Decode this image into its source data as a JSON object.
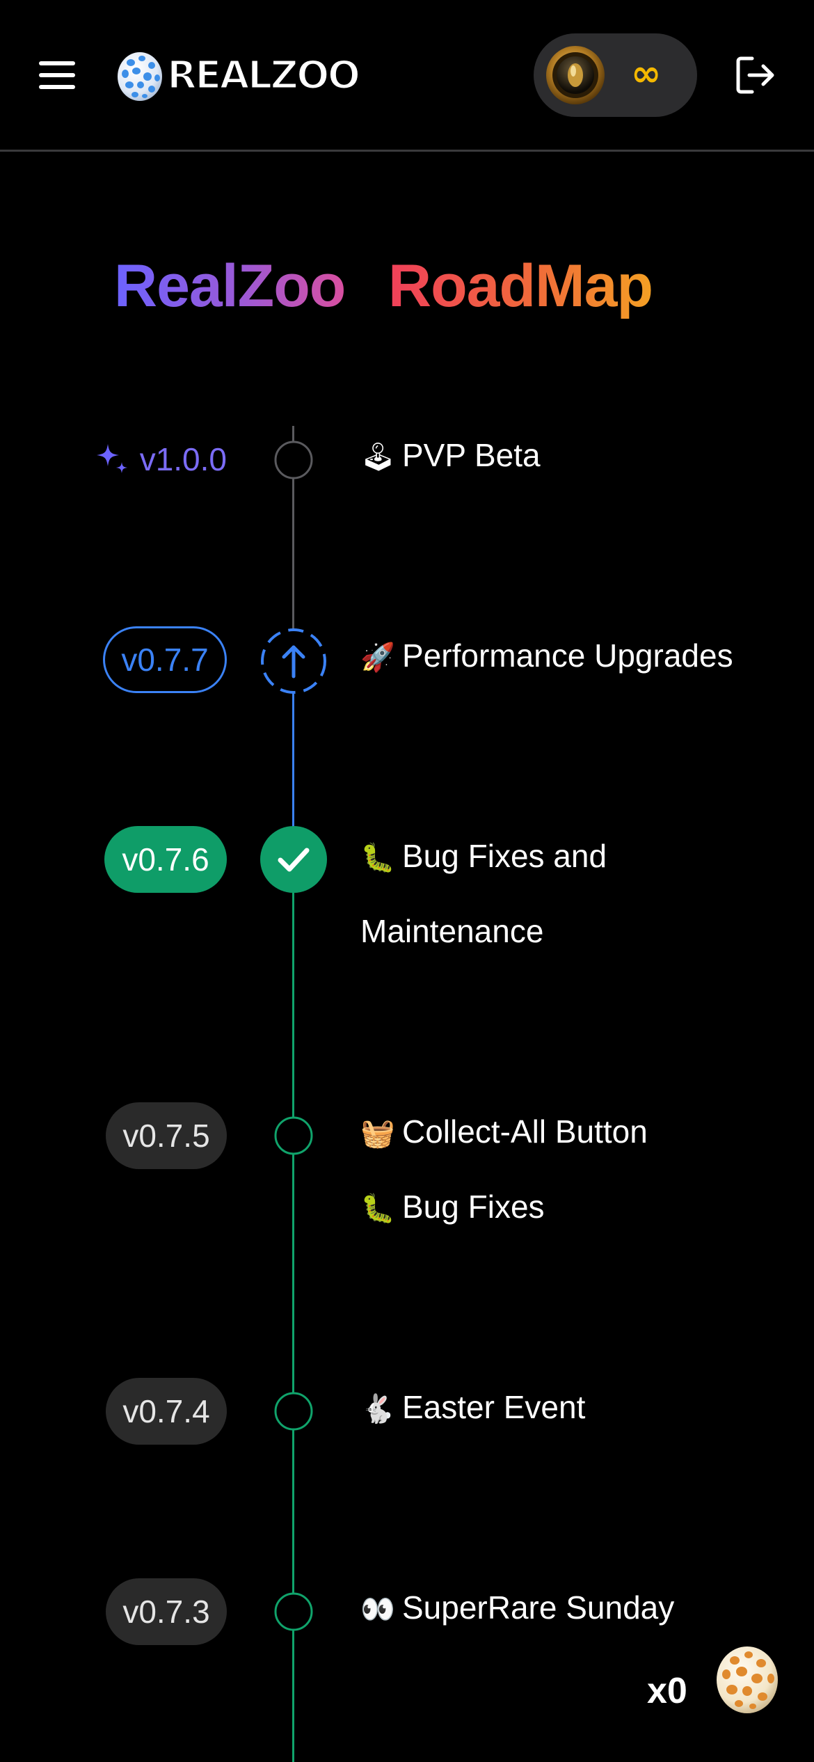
{
  "header": {
    "logo_text": "REALZOO",
    "balance": "∞",
    "icons": [
      "menu-icon",
      "egg-logo-icon",
      "coin-icon",
      "logout-icon"
    ]
  },
  "title": {
    "part1": "RealZoo",
    "part2": "RoadMap"
  },
  "colors": {
    "background": "#000000",
    "upcoming": "#7b6cf6",
    "in_progress": "#3b82f6",
    "released": "#0f9d68",
    "balance": "#f5b800"
  },
  "roadmap": [
    {
      "version": "v1.0.0",
      "status": "planned",
      "items": [
        {
          "emoji": "🕹",
          "text": "PVP Beta"
        }
      ]
    },
    {
      "version": "v0.7.7",
      "status": "in-progress",
      "items": [
        {
          "emoji": "🚀",
          "text": "Performance Upgrades"
        }
      ]
    },
    {
      "version": "v0.7.6",
      "status": "current",
      "items": [
        {
          "emoji": "🐛",
          "text": "Bug Fixes and"
        },
        {
          "emoji": "",
          "text": "Maintenance"
        }
      ]
    },
    {
      "version": "v0.7.5",
      "status": "released",
      "items": [
        {
          "emoji": "🧺",
          "text": "Collect-All Button"
        },
        {
          "emoji": "🐛",
          "text": "Bug Fixes"
        }
      ]
    },
    {
      "version": "v0.7.4",
      "status": "released",
      "items": [
        {
          "emoji": "🐇",
          "text": "Easter Event"
        }
      ]
    },
    {
      "version": "v0.7.3",
      "status": "released",
      "items": [
        {
          "emoji": "👀",
          "text": "SuperRare Sunday"
        }
      ]
    }
  ],
  "egg_counter": {
    "count": "x0"
  }
}
